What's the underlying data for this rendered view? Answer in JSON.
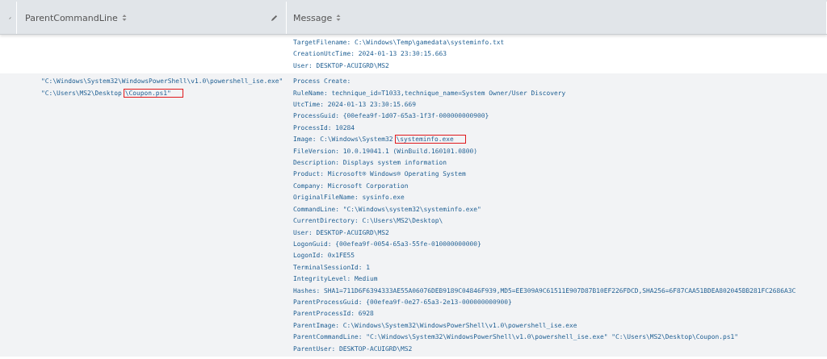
{
  "table": {
    "columns": [
      {
        "sortable": false,
        "editable": true
      },
      {
        "label": "ParentCommandLine",
        "sortable": true,
        "editable": true
      },
      {
        "label": "Message",
        "sortable": true,
        "editable": false
      }
    ],
    "rows": [
      {
        "parent_command_line": [],
        "message": [
          {
            "text": "TargetFilename: C:\\Windows\\Temp\\gamedata\\systeminfo.txt"
          },
          {
            "text": "CreationUtcTime: 2024-01-13 23:30:15.663"
          },
          {
            "text": "User: DESKTOP-ACUIGRD\\MS2"
          }
        ]
      },
      {
        "parent_command_line": [
          {
            "text": "\"C:\\Windows\\System32\\WindowsPowerShell\\v1.0\\powershell_ise.exe\""
          },
          {
            "text": "\"C:\\Users\\MS2\\Desktop",
            "highlight": "\\Coupon.ps1\""
          }
        ],
        "message": [
          {
            "text": "Process Create:"
          },
          {
            "text": "RuleName: technique_id=T1033,technique_name=System Owner/User Discovery"
          },
          {
            "text": "UtcTime: 2024-01-13 23:30:15.669"
          },
          {
            "text": "ProcessGuid: {00efea9f-1d07-65a3-1f3f-000000000900}"
          },
          {
            "text": "ProcessId: 10284"
          },
          {
            "text": "Image: C:\\Windows\\System32",
            "highlight": "\\systeminfo.exe"
          },
          {
            "text": "FileVersion: 10.0.19041.1 (WinBuild.160101.0800)"
          },
          {
            "text": "Description: Displays system information"
          },
          {
            "text": "Product: Microsoft® Windows® Operating System"
          },
          {
            "text": "Company: Microsoft Corporation"
          },
          {
            "text": "OriginalFileName: sysinfo.exe"
          },
          {
            "text": "CommandLine: \"C:\\Windows\\system32\\systeminfo.exe\""
          },
          {
            "text": "CurrentDirectory: C:\\Users\\MS2\\Desktop\\"
          },
          {
            "text": "User: DESKTOP-ACUIGRD\\MS2"
          },
          {
            "text": "LogonGuid: {00efea9f-0054-65a3-55fe-010000000000}"
          },
          {
            "text": "LogonId: 0x1FE55"
          },
          {
            "text": "TerminalSessionId: 1"
          },
          {
            "text": "IntegrityLevel: Medium"
          },
          {
            "text": "Hashes: SHA1=711D6F6394333AE55A06076DEB9189C04846F939,MD5=EE309A9C61511E907D87B10EF226FDCD,SHA256=6F87CAA51BDEA802045BB281FC2686A3C"
          },
          {
            "text": "ParentProcessGuid: {00efea9f-0e27-65a3-2e13-000000000900}"
          },
          {
            "text": "ParentProcessId: 6928"
          },
          {
            "text": "ParentImage: C:\\Windows\\System32\\WindowsPowerShell\\v1.0\\powershell_ise.exe"
          },
          {
            "text": "ParentCommandLine: \"C:\\Windows\\System32\\WindowsPowerShell\\v1.0\\powershell_ise.exe\" \"C:\\Users\\MS2\\Desktop\\Coupon.ps1\""
          },
          {
            "text": "ParentUser: DESKTOP-ACUIGRD\\MS2"
          }
        ]
      }
    ]
  }
}
